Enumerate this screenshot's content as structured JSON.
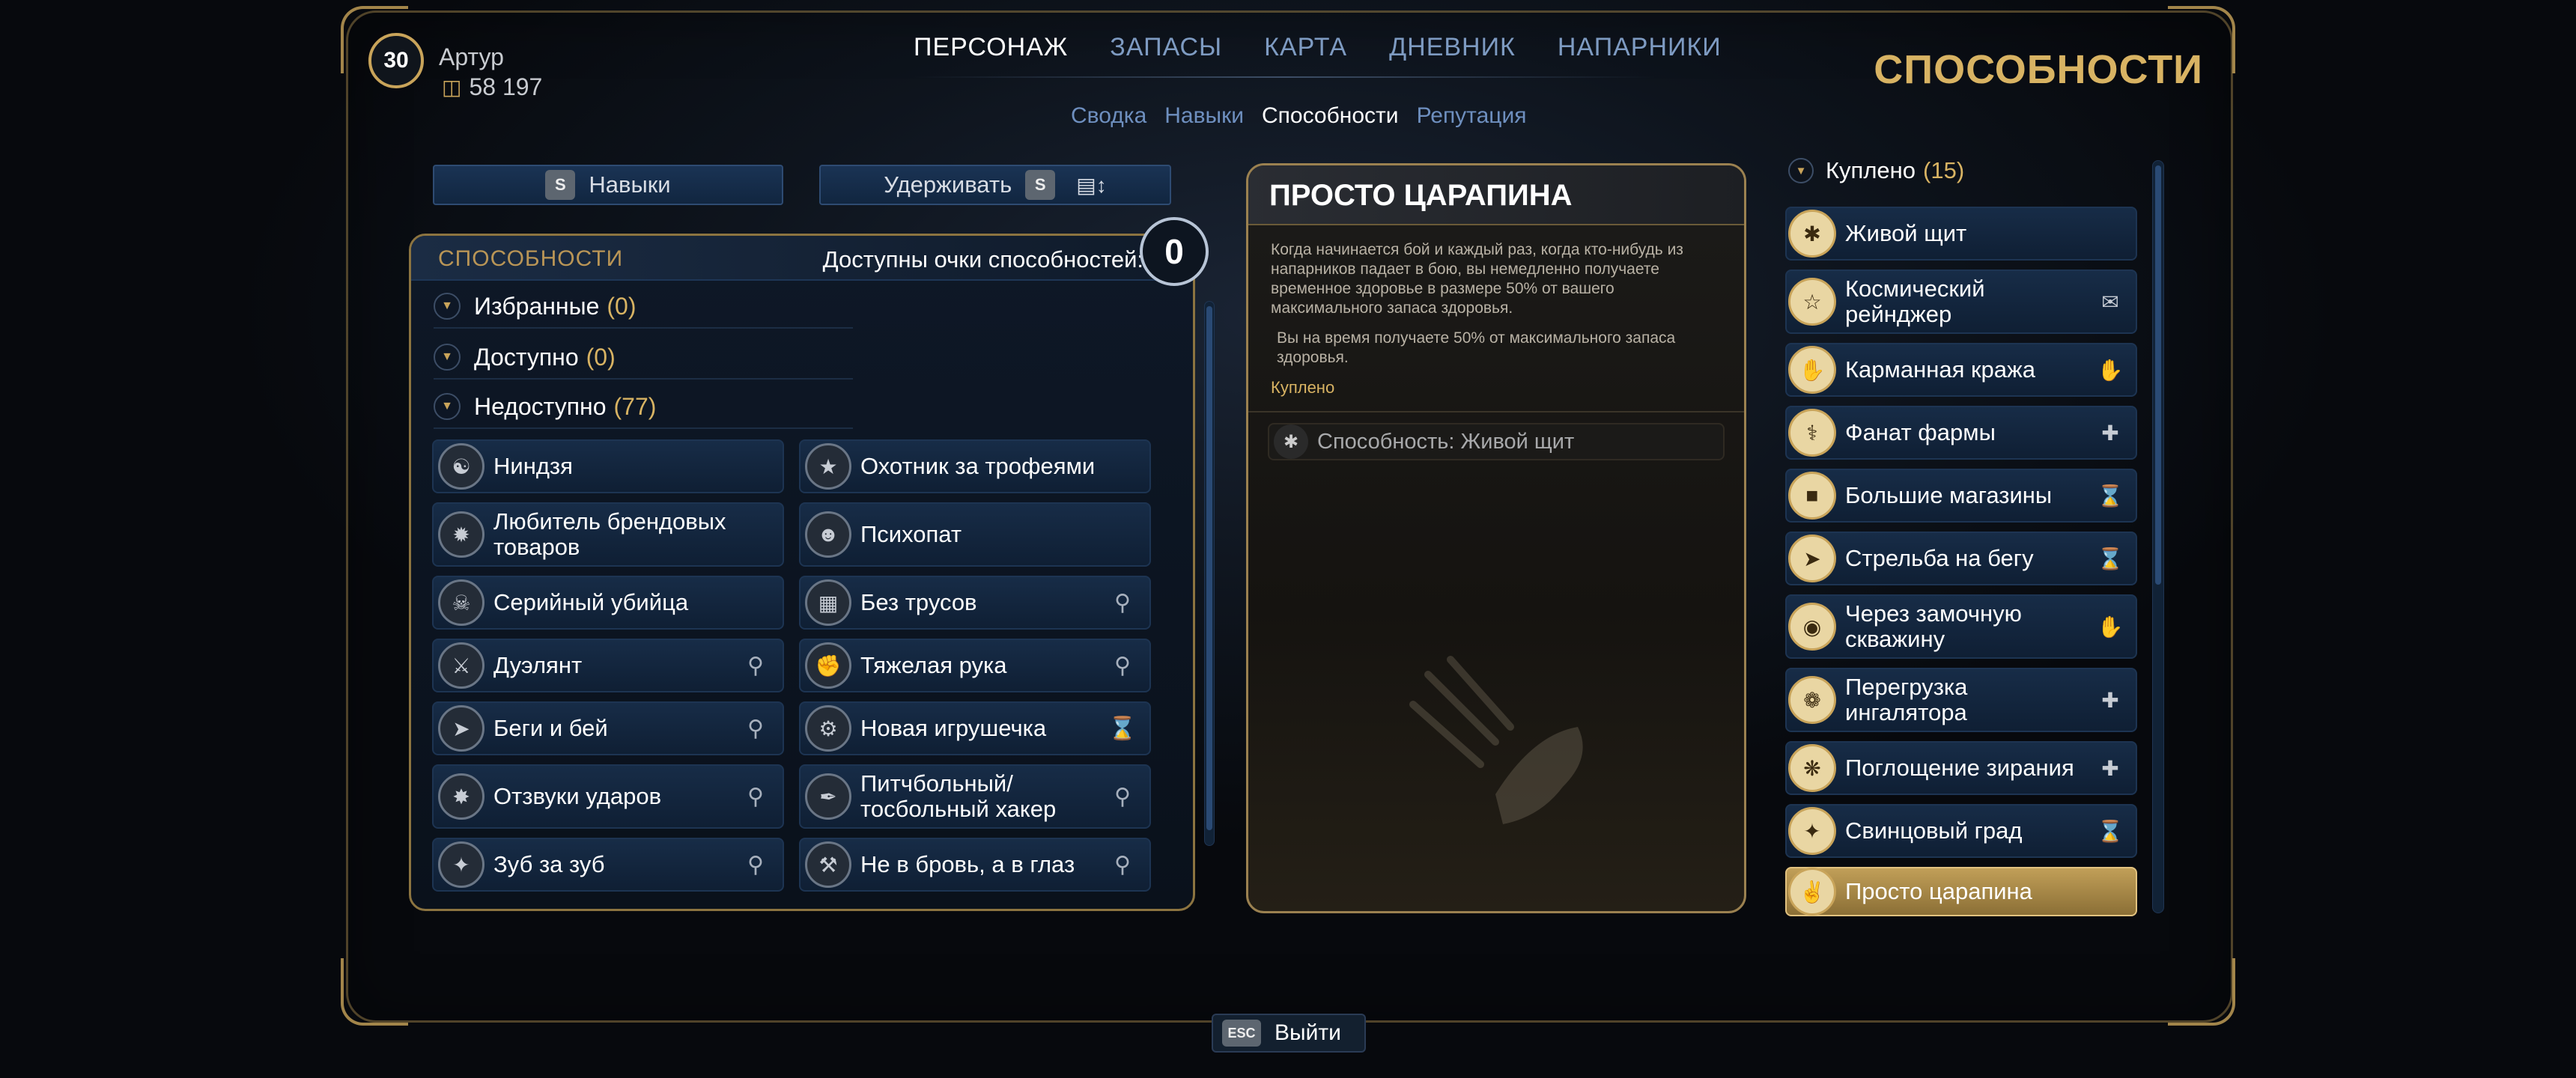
{
  "player": {
    "level": "30",
    "name": "Артур",
    "money": "58 197"
  },
  "topnav": {
    "items": [
      "ПЕРСОНАЖ",
      "ЗАПАСЫ",
      "КАРТА",
      "ДНЕВНИК",
      "НАПАРНИКИ"
    ]
  },
  "subnav": {
    "items": [
      "Сводка",
      "Навыки",
      "Способности",
      "Репутация"
    ]
  },
  "section_title": "СПОСОБНОСТИ",
  "buttons": {
    "skills_key": "S",
    "skills_label": "Навыки",
    "hold_label": "Удерживать",
    "hold_key": "S"
  },
  "left": {
    "header": "СПОСОБНОСТИ",
    "points_label": "Доступны очки способностей:",
    "points": "0",
    "categories": [
      {
        "name": "Избранные",
        "count": "(0)"
      },
      {
        "name": "Доступно",
        "count": "(0)"
      },
      {
        "name": "Недоступно",
        "count": "(77)"
      }
    ],
    "col1": [
      "Ниндзя",
      "Любитель брендовых товаров",
      "Серийный убийца",
      "Дуэлянт",
      "Беги и бей",
      "Отзвуки ударов",
      "Зуб за зуб"
    ],
    "col2": [
      "Охотник за трофеями",
      "Психопат",
      "Без трусов",
      "Тяжелая рука",
      "Новая игрушечка",
      "Питчбольный/ тосбольный хакер",
      "Не в бровь, а в глаз"
    ]
  },
  "detail": {
    "title": "ПРОСТО ЦАРАПИНА",
    "desc": "Когда начинается бой и каждый раз, когда кто-нибудь из напарников падает в бою, вы немедленно получаете временное здоровье в размере 50% от вашего максимального запаса здоровья.",
    "desc2": "Вы на время получаете 50% от максимального запаса здоровья.",
    "status": "Куплено",
    "related": "Способность: Живой щит"
  },
  "right": {
    "header": "Куплено",
    "count": "(15)",
    "items": [
      "Живой щит",
      "Космический рейнджер",
      "Карманная кража",
      "Фанат фармы",
      "Большие магазины",
      "Стрельба на бегу",
      "Через замочную скважину",
      "Перегрузка ингалятора",
      "Поглощение зирания",
      "Свинцовый град",
      "Просто царапина"
    ]
  },
  "exit": {
    "key": "ESC",
    "label": "Выйти"
  }
}
